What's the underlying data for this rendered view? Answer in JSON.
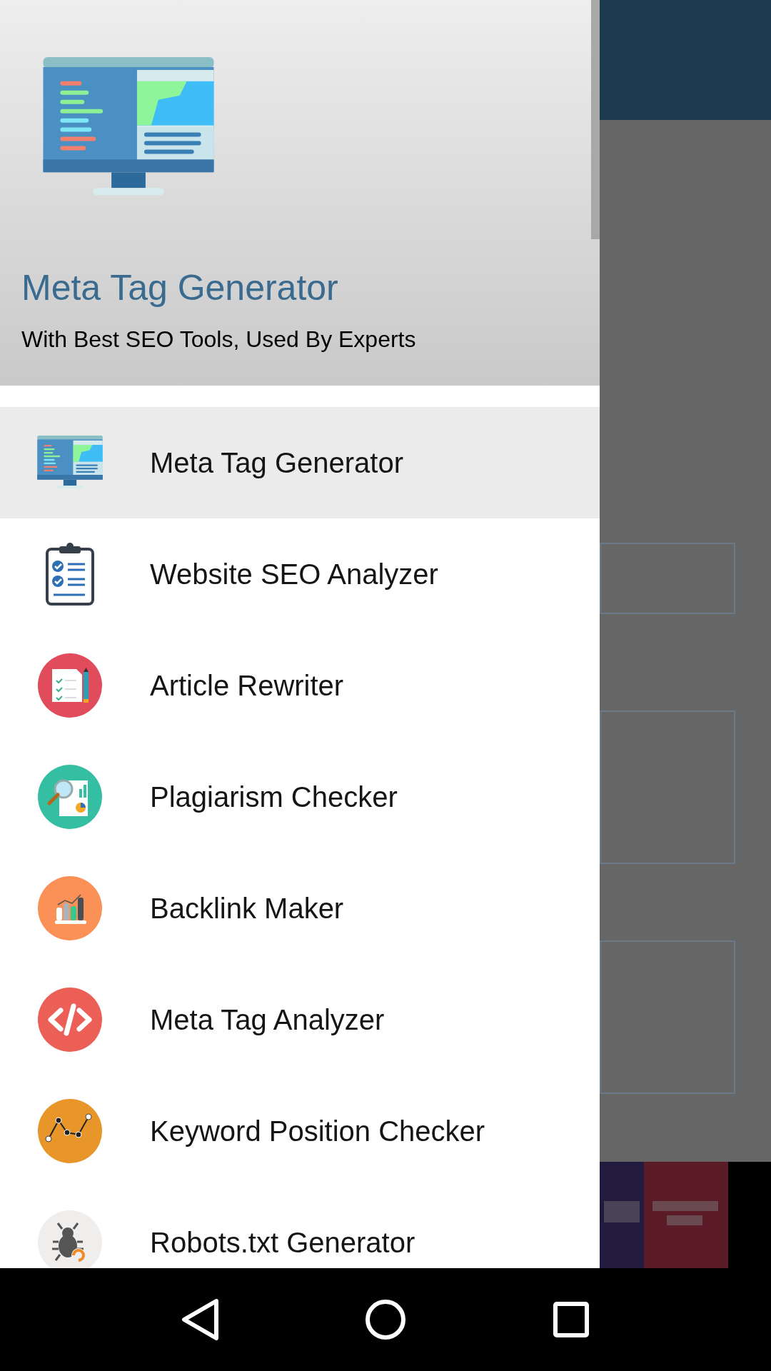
{
  "drawer": {
    "header": {
      "title": "Meta Tag Generator",
      "subtitle": "With Best SEO Tools, Used By Experts"
    },
    "items": [
      {
        "label": "Meta Tag Generator",
        "kind": "monitor",
        "selected": true
      },
      {
        "label": "Website SEO Analyzer",
        "kind": "clipboard",
        "selected": false
      },
      {
        "label": "Article Rewriter",
        "kind": "document",
        "selected": false
      },
      {
        "label": "Plagiarism Checker",
        "kind": "magnifier",
        "selected": false
      },
      {
        "label": "Backlink Maker",
        "kind": "bar-chart",
        "selected": false
      },
      {
        "label": "Meta Tag Analyzer",
        "kind": "code",
        "selected": false
      },
      {
        "label": "Keyword Position Checker",
        "kind": "line-chart",
        "selected": false
      },
      {
        "label": "Robots.txt Generator",
        "kind": "bug",
        "selected": false
      }
    ]
  }
}
